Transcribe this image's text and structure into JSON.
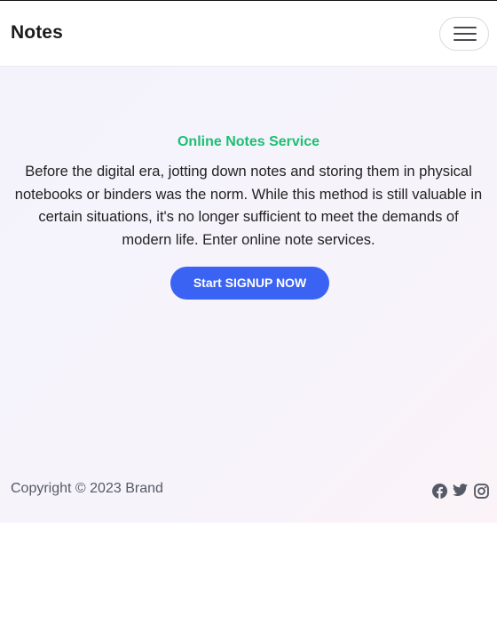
{
  "navbar": {
    "brand": "Notes",
    "toggler_icon": "hamburger-menu-icon"
  },
  "hero": {
    "heading": "Online Notes Service",
    "body": "Before the digital era, jotting down notes and storing them in physical notebooks or binders was the norm. While this method is still valuable in certain situations, it's no longer sufficient to meet the demands of modern life. Enter online note services.",
    "cta_label": "Start SIGNUP NOW"
  },
  "footer": {
    "copyright": "Copyright © 2023 Brand",
    "social_icons": [
      "facebook-icon",
      "twitter-icon",
      "instagram-icon"
    ]
  },
  "colors": {
    "accent_green": "#1dbf73",
    "button_blue": "#3b63f3",
    "text_dark": "#222222",
    "footer_text": "#555a66"
  }
}
